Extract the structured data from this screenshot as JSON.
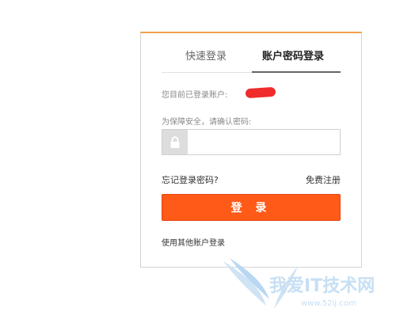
{
  "tabs": {
    "quick_login": "快速登录",
    "password_login": "账户密码登录"
  },
  "account": {
    "label": "您目前已登录账户:"
  },
  "password": {
    "label": "为保障安全，请确认密码:",
    "value": "",
    "placeholder": ""
  },
  "links": {
    "forgot_password": "忘记登录密码?",
    "register": "免费注册",
    "other_account": "使用其他账户登录"
  },
  "login_button": {
    "label": "登 录"
  },
  "watermark": {
    "brand_text": "我爱IT技术网",
    "url_text": "www.52ij.com"
  },
  "colors": {
    "accent_top_border": "#f0a04b",
    "login_button": "#ff5a17",
    "redaction": "#ef2b2b",
    "watermark": "#b9d7f2"
  },
  "icons": {
    "lock": "lock-icon"
  }
}
